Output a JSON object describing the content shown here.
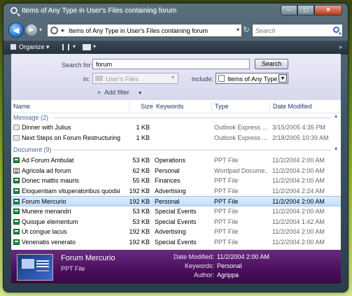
{
  "window": {
    "title": "Items of Any Type in User's Files containing forum"
  },
  "address_bar": {
    "path": "Items of Any Type in User's Files containing forum",
    "search_placeholder": "Search"
  },
  "command_bar": {
    "organize_label": "Organize"
  },
  "search_pane": {
    "search_for_label": "Search for:",
    "search_for_value": "forum",
    "search_button": "Search",
    "in_label": "in:",
    "in_value": "User's Files",
    "include_label": "include:",
    "include_value": "Items of Any Type",
    "add_filter": "Add filter"
  },
  "columns": {
    "name": "Name",
    "size": "Size",
    "keywords": "Keywords",
    "type": "Type",
    "date": "Date Modified"
  },
  "groups": [
    {
      "title": "Message (2)",
      "items": [
        {
          "icon": "mail-icon",
          "name": "Dinner with Julius",
          "size": "1 KB",
          "keywords": "",
          "type": "Outlook Express ...",
          "date": "3/15/2005 4:35 PM"
        },
        {
          "icon": "mail-icon",
          "name": "Next Steps on Forum Restructuring",
          "size": "1 KB",
          "keywords": "",
          "type": "Outlook Express ...",
          "date": "2/18/2005 10:39 AM"
        }
      ]
    },
    {
      "title": "Document (9)",
      "items": [
        {
          "icon": "ppt-icon",
          "name": "Ad Forum Ambulat",
          "size": "53 KB",
          "keywords": "Operations",
          "type": "PPT File",
          "date": "11/2/2004 2:00 AM"
        },
        {
          "icon": "wordpad-icon",
          "name": "Agricola ad forum",
          "size": "62 KB",
          "keywords": "Personal",
          "type": "Wordpad Docume...",
          "date": "11/2/2004 2:00 AM"
        },
        {
          "icon": "ppt-icon",
          "name": "Donec mattis mauris",
          "size": "55 KB",
          "keywords": "Finances",
          "type": "PPT File",
          "date": "11/2/2004 2:00 AM"
        },
        {
          "icon": "ppt-icon",
          "name": "Eloquentiam vituperatoribus quodsi",
          "size": "192 KB",
          "keywords": "Advertising",
          "type": "PPT File",
          "date": "11/2/2004 2:24 AM"
        },
        {
          "icon": "ppt-icon",
          "name": "Forum Mercurio",
          "size": "192 KB",
          "keywords": "Personal",
          "type": "PPT File",
          "date": "11/2/2004 2:00 AM",
          "selected": true
        },
        {
          "icon": "ppt-icon",
          "name": "Munere menandri",
          "size": "53 KB",
          "keywords": "Special Events",
          "type": "PPT File",
          "date": "11/2/2004 2:00 AM"
        },
        {
          "icon": "ppt-icon",
          "name": "Quisque elementum",
          "size": "53 KB",
          "keywords": "Special Events",
          "type": "PPT File",
          "date": "11/2/2004 1:42 AM"
        },
        {
          "icon": "ppt-icon",
          "name": "Ut congue lacus",
          "size": "192 KB",
          "keywords": "Advertising",
          "type": "PPT File",
          "date": "11/2/2004 2:00 AM"
        },
        {
          "icon": "ppt-icon",
          "name": "Venenatis venerato",
          "size": "192 KB",
          "keywords": "Special Events",
          "type": "PPT File",
          "date": "11/2/2004 2:00 AM"
        }
      ]
    }
  ],
  "details": {
    "name": "Forum Mercurio",
    "type": "PPT File",
    "date_label": "Date Modified:",
    "date_value": "11/2/2004 2:00 AM",
    "keywords_label": "Keywords:",
    "keywords_value": "Personal",
    "author_label": "Author:",
    "author_value": "Agrippa"
  },
  "colors": {
    "selection": "#c4ddf7",
    "details_bg": "#4a0f5c",
    "search_pane_bg": "#e2e2f2"
  }
}
